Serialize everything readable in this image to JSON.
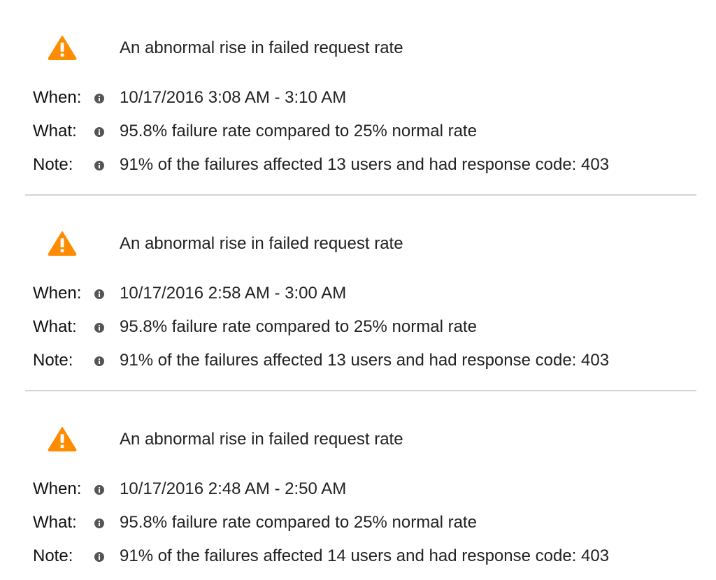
{
  "colors": {
    "warning": "#FF8C00",
    "info_icon": "#555555",
    "divider": "#d4d4d4"
  },
  "alerts": [
    {
      "icon": "warning-triangle-icon",
      "title": "An abnormal rise in failed request rate",
      "when_label": "When:",
      "when_value": "10/17/2016 3:08 AM - 3:10 AM",
      "what_label": "What:",
      "what_value": "95.8% failure rate compared to 25% normal rate",
      "note_label": "Note:",
      "note_value": "91% of the failures affected 13 users and had response code: 403"
    },
    {
      "icon": "warning-triangle-icon",
      "title": "An abnormal rise in failed request rate",
      "when_label": "When:",
      "when_value": "10/17/2016 2:58 AM - 3:00 AM",
      "what_label": "What:",
      "what_value": "95.8% failure rate compared to 25% normal rate",
      "note_label": "Note:",
      "note_value": "91% of the failures affected 13 users and had response code: 403"
    },
    {
      "icon": "warning-triangle-icon",
      "title": "An abnormal rise in failed request rate",
      "when_label": "When:",
      "when_value": "10/17/2016 2:48 AM - 2:50 AM",
      "what_label": "What:",
      "what_value": "95.8% failure rate compared to 25% normal rate",
      "note_label": "Note:",
      "note_value": "91% of the failures affected 14 users and had response code: 403"
    }
  ]
}
